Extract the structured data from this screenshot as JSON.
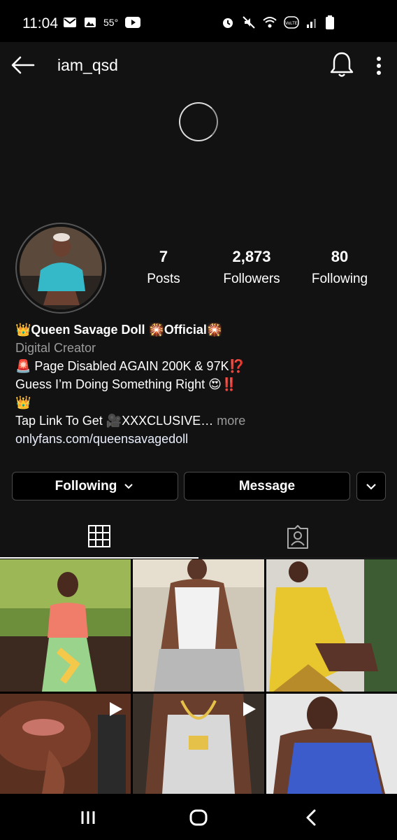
{
  "status_bar": {
    "time": "11:04",
    "temperature": "55°",
    "left_icons": [
      "mail-icon",
      "image-icon",
      "youtube-icon"
    ],
    "right_icons": [
      "alarm-icon",
      "mute-icon",
      "wifi-icon",
      "volte-icon",
      "signal-icon",
      "battery-icon"
    ]
  },
  "header": {
    "username": "iam_qsd",
    "icons": [
      "back-arrow-icon",
      "bell-icon",
      "more-vertical-icon"
    ]
  },
  "profile": {
    "stats": [
      {
        "value": "7",
        "label": "Posts"
      },
      {
        "value": "2,873",
        "label": "Followers"
      },
      {
        "value": "80",
        "label": "Following"
      }
    ],
    "bio": {
      "name": "👑Queen Savage Doll 🎇Official🎇",
      "category": "Digital Creator",
      "line1": "🚨 Page Disabled AGAIN 200K & 97K⁉️",
      "line2": "Guess I’m Doing Something Right 😍‼️",
      "line3": "👑",
      "line4": "Tap Link To Get 🎥XXXCLUSIVE…",
      "more": " more",
      "link": "onlyfans.com/queensavagedoll"
    },
    "buttons": {
      "following": "Following",
      "message": "Message"
    }
  },
  "tabs": [
    "grid-icon",
    "tagged-icon"
  ],
  "grid_posts": [
    {
      "type": "photo"
    },
    {
      "type": "photo"
    },
    {
      "type": "photo"
    },
    {
      "type": "video"
    },
    {
      "type": "video"
    },
    {
      "type": "photo"
    }
  ],
  "nav": [
    "recent-apps-icon",
    "home-icon",
    "back-icon"
  ],
  "colors": {
    "background": "#121212",
    "secondary_text": "#9b9b9b",
    "button_border": "#4a4a4a"
  }
}
